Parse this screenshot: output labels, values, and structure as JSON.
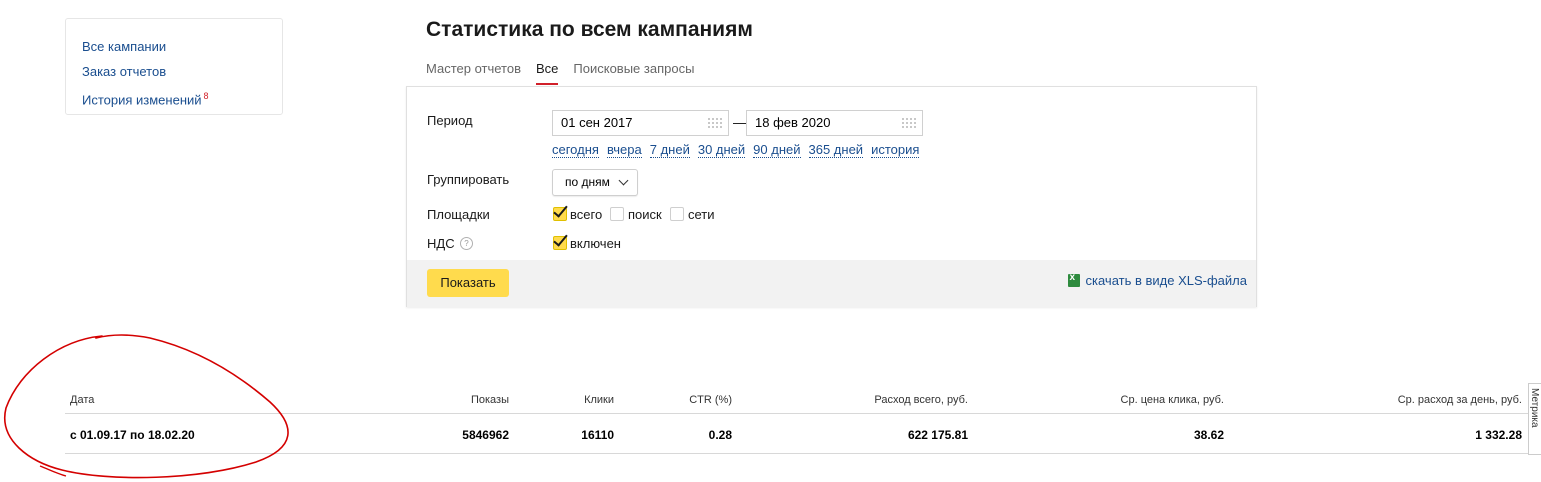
{
  "sidebar": {
    "items": [
      {
        "label": "Все кампании"
      },
      {
        "label": "Заказ отчетов"
      },
      {
        "label": "История изменений",
        "badge": "8"
      }
    ]
  },
  "page": {
    "title": "Статистика по всем кампаниям"
  },
  "tabs": [
    {
      "label": "Мастер отчетов",
      "active": false
    },
    {
      "label": "Все",
      "active": true
    },
    {
      "label": "Поисковые запросы",
      "active": false
    }
  ],
  "filters": {
    "period_label": "Период",
    "date_from": "01 сен 2017",
    "date_to": "18 фев 2020",
    "dash": "—",
    "quick_links": [
      "сегодня",
      "вчера",
      "7 дней",
      "30 дней",
      "90 дней",
      "365 дней",
      "история"
    ],
    "group_label": "Группировать",
    "group_value": "по дням",
    "platforms_label": "Площадки",
    "platforms": [
      {
        "label": "всего",
        "checked": true
      },
      {
        "label": "поиск",
        "checked": false
      },
      {
        "label": "сети",
        "checked": false
      }
    ],
    "vat_label": "НДС",
    "vat_help": "?",
    "vat_option": {
      "label": "включен",
      "checked": true
    },
    "show_button": "Показать",
    "xls_link": "скачать в виде XLS-файла"
  },
  "table": {
    "headers": [
      "Дата",
      "Показы",
      "Клики",
      "CTR (%)",
      "Расход всего, руб.",
      "Ср. цена клика, руб.",
      "Ср. расход за день, руб."
    ],
    "rows": [
      [
        "с 01.09.17 по 18.02.20",
        "5846962",
        "16110",
        "0.28",
        "622 175.81",
        "38.62",
        "1 332.28"
      ]
    ]
  },
  "side_tab": {
    "label": "Метрика"
  },
  "colors": {
    "accent": "#ffdb4d",
    "link": "#1a4e8f",
    "tab_underline": "#d1202a",
    "annotation": "#d40000"
  }
}
